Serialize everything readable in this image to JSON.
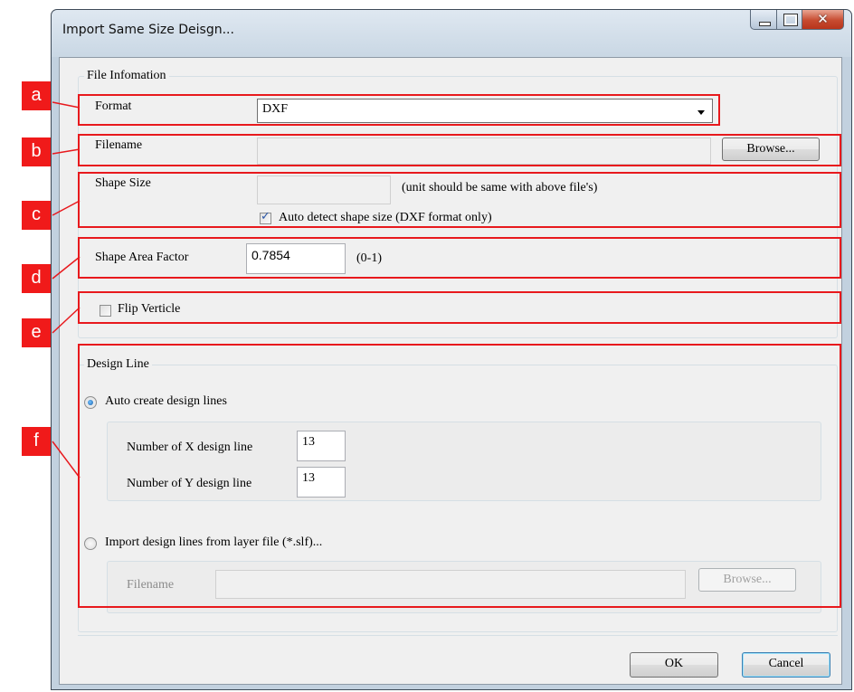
{
  "window": {
    "title": "Import Same Size Deisgn..."
  },
  "file_info": {
    "group_title": "File Infomation",
    "format_label": "Format",
    "format_value": "DXF",
    "filename_label": "Filename",
    "filename_value": "",
    "browse_label": "Browse...",
    "shape_size_label": "Shape Size",
    "shape_size_value": "",
    "shape_size_note": "(unit should be same with above file's)",
    "auto_detect_label": "Auto detect shape size (DXF format only)",
    "auto_detect_checked": true,
    "area_factor_label": "Shape Area Factor",
    "area_factor_value": "0.7854",
    "area_factor_range": "(0-1)",
    "flip_label": "Flip Verticle",
    "flip_checked": false
  },
  "design_line": {
    "group_title": "Design Line",
    "auto_create_label": "Auto create design lines",
    "x_label": "Number of X design line",
    "x_value": "13",
    "y_label": "Number of Y design line",
    "y_value": "13",
    "import_label": "Import design lines from layer file (*.slf)...",
    "import_filename_label": "Filename",
    "import_filename_value": "",
    "import_browse_label": "Browse..."
  },
  "buttons": {
    "ok": "OK",
    "cancel": "Cancel"
  },
  "annotations": [
    "a",
    "b",
    "c",
    "d",
    "e",
    "f"
  ],
  "colors": {
    "annotation_red": "#f01a1a",
    "client_bg": "#f0f0f0"
  }
}
